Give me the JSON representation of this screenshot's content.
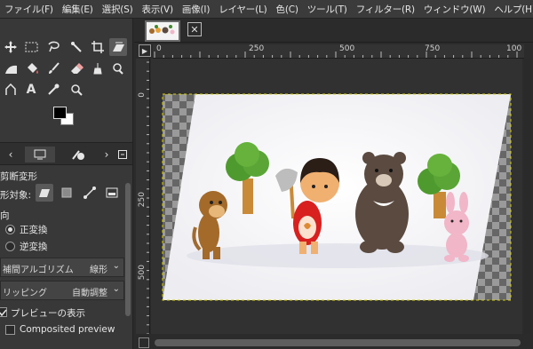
{
  "menubar": {
    "items": [
      "ファイル(F)",
      "編集(E)",
      "選択(S)",
      "表示(V)",
      "画像(I)",
      "レイヤー(L)",
      "色(C)",
      "ツール(T)",
      "フィルター(R)",
      "ウィンドウ(W)",
      "ヘルプ(H)"
    ]
  },
  "toolbox": {
    "text_tool_glyph": "A"
  },
  "tool_options": {
    "title": "剪断変形",
    "target_label": "形対象:",
    "direction_label": "向",
    "direction_options": [
      "正変換",
      "逆変換"
    ],
    "direction_selected": "正変換",
    "interpolation_label": "補間アルゴリズム",
    "interpolation_value": "線形",
    "clipping_label": "リッピング",
    "clipping_value": "自動調整",
    "show_preview_label": "プレビューの表示",
    "show_preview_checked": true,
    "composited_preview_label": "Composited preview",
    "composited_preview_checked": false
  },
  "canvas": {
    "ruler_h_labels": [
      "0",
      "250",
      "500",
      "750",
      "100"
    ],
    "ruler_v_labels": [
      "0",
      "250",
      "500"
    ]
  },
  "colors": {
    "foreground": "#000000",
    "background": "#ffffff",
    "selection_border": "#d6d000"
  }
}
